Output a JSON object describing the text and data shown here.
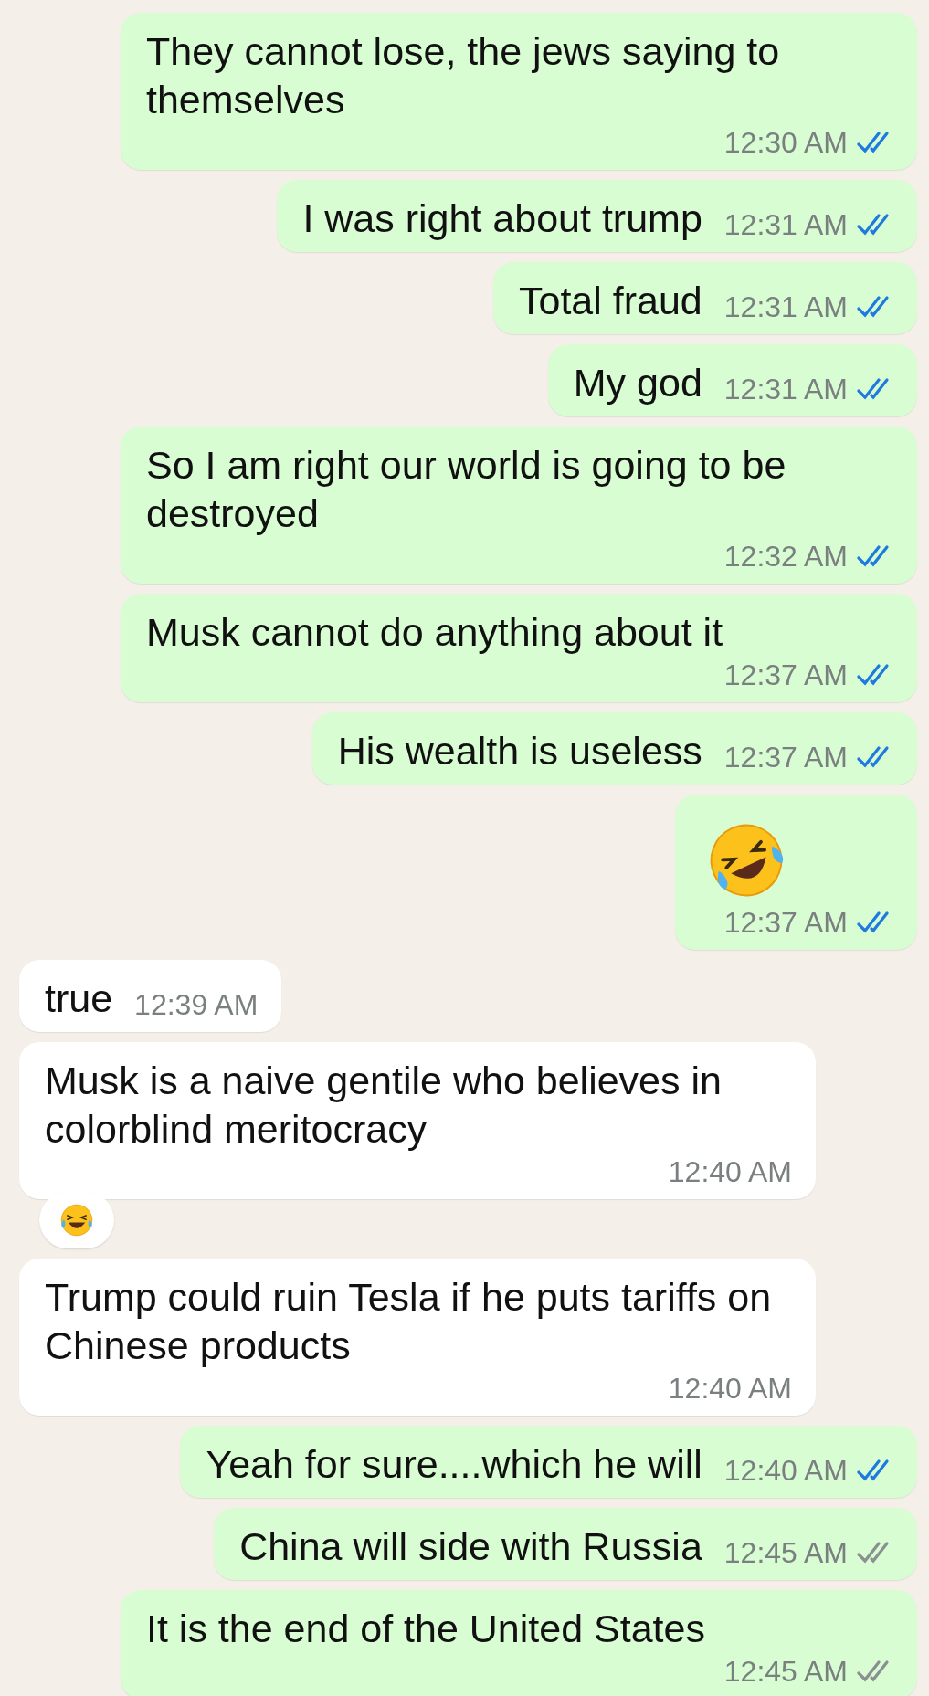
{
  "messages": [
    {
      "outgoing": true,
      "kind": "text",
      "text": "They cannot lose, the jews saying to themselves",
      "time": "12:30 AM",
      "read": true
    },
    {
      "outgoing": true,
      "kind": "text",
      "text": "I was right about trump",
      "time": "12:31 AM",
      "read": true
    },
    {
      "outgoing": true,
      "kind": "text",
      "text": "Total fraud",
      "time": "12:31 AM",
      "read": true
    },
    {
      "outgoing": true,
      "kind": "text",
      "text": "My god",
      "time": "12:31 AM",
      "read": true
    },
    {
      "outgoing": true,
      "kind": "text",
      "text": "So I am right our world is going to be destroyed",
      "time": "12:32 AM",
      "read": true
    },
    {
      "outgoing": true,
      "kind": "text",
      "text": "Musk cannot do anything about it",
      "time": "12:37 AM",
      "read": true
    },
    {
      "outgoing": true,
      "kind": "text",
      "text": "His wealth is useless",
      "time": "12:37 AM",
      "read": true
    },
    {
      "outgoing": true,
      "kind": "emoji",
      "time": "12:37 AM",
      "read": true
    },
    {
      "outgoing": false,
      "kind": "text",
      "text": "true",
      "time": "12:39 AM",
      "reaction": false
    },
    {
      "outgoing": false,
      "kind": "text",
      "text": "Musk is a naive gentile who believes in colorblind meritocracy",
      "time": "12:40 AM",
      "reaction": true
    },
    {
      "outgoing": false,
      "kind": "text",
      "text": "Trump could ruin Tesla if he puts tariffs on Chinese products",
      "time": "12:40 AM",
      "reaction": false
    },
    {
      "outgoing": true,
      "kind": "text",
      "text": "Yeah for sure....which he will",
      "time": "12:40 AM",
      "read": true
    },
    {
      "outgoing": true,
      "kind": "text",
      "text": "China will side with Russia",
      "time": "12:45 AM",
      "read": false
    },
    {
      "outgoing": true,
      "kind": "text",
      "text": "It is the end of the United States",
      "time": "12:45 AM",
      "read": false
    }
  ]
}
